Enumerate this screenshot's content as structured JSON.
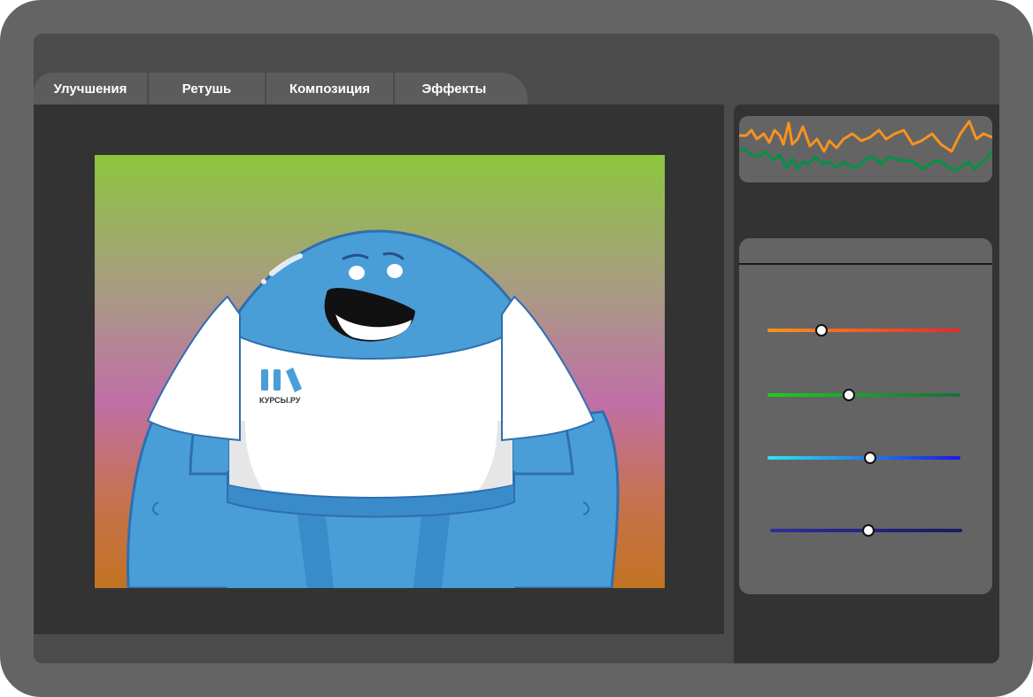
{
  "tabs": [
    {
      "label": "Улучшения"
    },
    {
      "label": "Ретушь"
    },
    {
      "label": "Композиция"
    },
    {
      "label": "Эффекты"
    }
  ],
  "image": {
    "logo_text": "КУРСЫ.РУ"
  },
  "histogram": {
    "orange_color": "#f7931e",
    "green_color": "#009245"
  },
  "adjustments": {
    "sliders": [
      {
        "name": "orange-red",
        "value": 0.28,
        "colors": [
          "#f7931e",
          "#e8282b"
        ]
      },
      {
        "name": "green",
        "value": 0.42,
        "colors": [
          "#1bd01b",
          "#1a6e3c"
        ]
      },
      {
        "name": "cyan-blue",
        "value": 0.53,
        "colors": [
          "#2ee6f0",
          "#1a18e6"
        ]
      },
      {
        "name": "indigo",
        "value": 0.51,
        "colors": [
          "#2e2e9c",
          "#1b1b5e"
        ]
      }
    ]
  }
}
